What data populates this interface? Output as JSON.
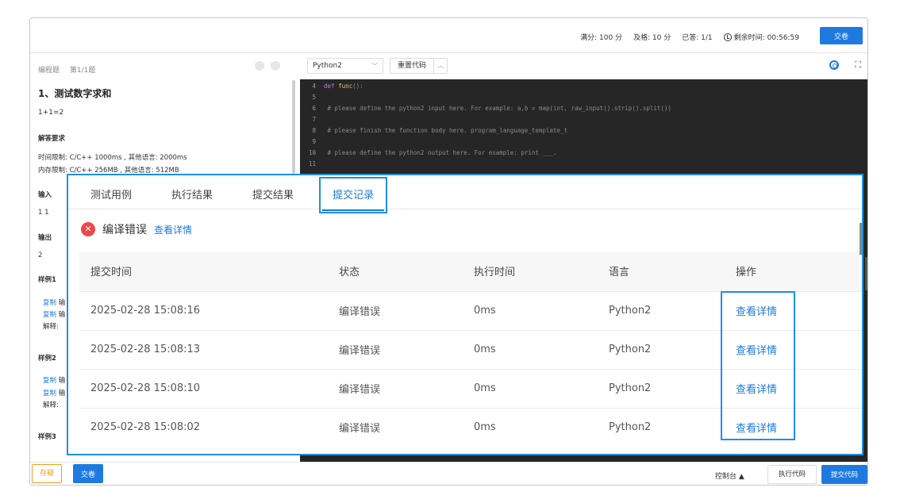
{
  "topbar": {
    "full_score": "满分: 100 分",
    "pass_score": "及格: 10 分",
    "answered": "已答: 1/1",
    "remaining": "剩余时间: 00:56:59",
    "submit_label": "交卷"
  },
  "left": {
    "type": "编程题",
    "index": "第1/1题",
    "title": "1、测试数字求和",
    "desc": "1+1=2",
    "req_heading": "解答要求",
    "time_limit": "时间限制: C/C++ 1000ms , 其他语言: 2000ms",
    "mem_limit": "内存限制: C/C++ 256MB , 其他语言: 512MB",
    "input_heading": "输入",
    "input_value": "1 1",
    "output_heading": "输出",
    "output_value": "2",
    "example1": "样例1",
    "example2": "样例2",
    "example3": "样例3",
    "copy": "复制",
    "in_abbr": "输",
    "explain": "解释:"
  },
  "editor": {
    "language": "Python2",
    "reset_label": "重置代码",
    "lines": [
      {
        "no": "4",
        "text": "def func():"
      },
      {
        "no": "5",
        "text": ""
      },
      {
        "no": "6",
        "text": "    # please define the python2 input here. For example: a,b = map(int, raw_input().strip().split())"
      },
      {
        "no": "7",
        "text": ""
      },
      {
        "no": "8",
        "text": "    # please finish the function body here. program_language_template_t"
      },
      {
        "no": "9",
        "text": ""
      },
      {
        "no": "10",
        "text": "    # please define the python2 output here. For example: print ___."
      },
      {
        "no": "11",
        "text": ""
      }
    ]
  },
  "bottombar": {
    "save_label": "存疑",
    "submit_label": "交卷",
    "console_label": "控制台 ▲",
    "run_label": "执行代码",
    "submit_code_label": "提交代码"
  },
  "panel": {
    "tabs": [
      "测试用例",
      "执行结果",
      "提交结果",
      "提交记录"
    ],
    "status_text": "编译错误",
    "status_link": "查看详情",
    "columns": [
      "提交时间",
      "状态",
      "执行时间",
      "语言",
      "操作"
    ],
    "rows": [
      {
        "time": "2025-02-28 15:08:16",
        "status": "编译错误",
        "duration": "0ms",
        "lang": "Python2",
        "action": "查看详情"
      },
      {
        "time": "2025-02-28 15:08:13",
        "status": "编译错误",
        "duration": "0ms",
        "lang": "Python2",
        "action": "查看详情"
      },
      {
        "time": "2025-02-28 15:08:10",
        "status": "编译错误",
        "duration": "0ms",
        "lang": "Python2",
        "action": "查看详情"
      },
      {
        "time": "2025-02-28 15:08:02",
        "status": "编译错误",
        "duration": "0ms",
        "lang": "Python2",
        "action": "查看详情"
      }
    ]
  },
  "colors": {
    "accent": "#1f7ae0",
    "highlight_border": "#1e8fe6",
    "error": "#f04848",
    "warn": "#f0a020",
    "editor_bg": "#262626"
  }
}
